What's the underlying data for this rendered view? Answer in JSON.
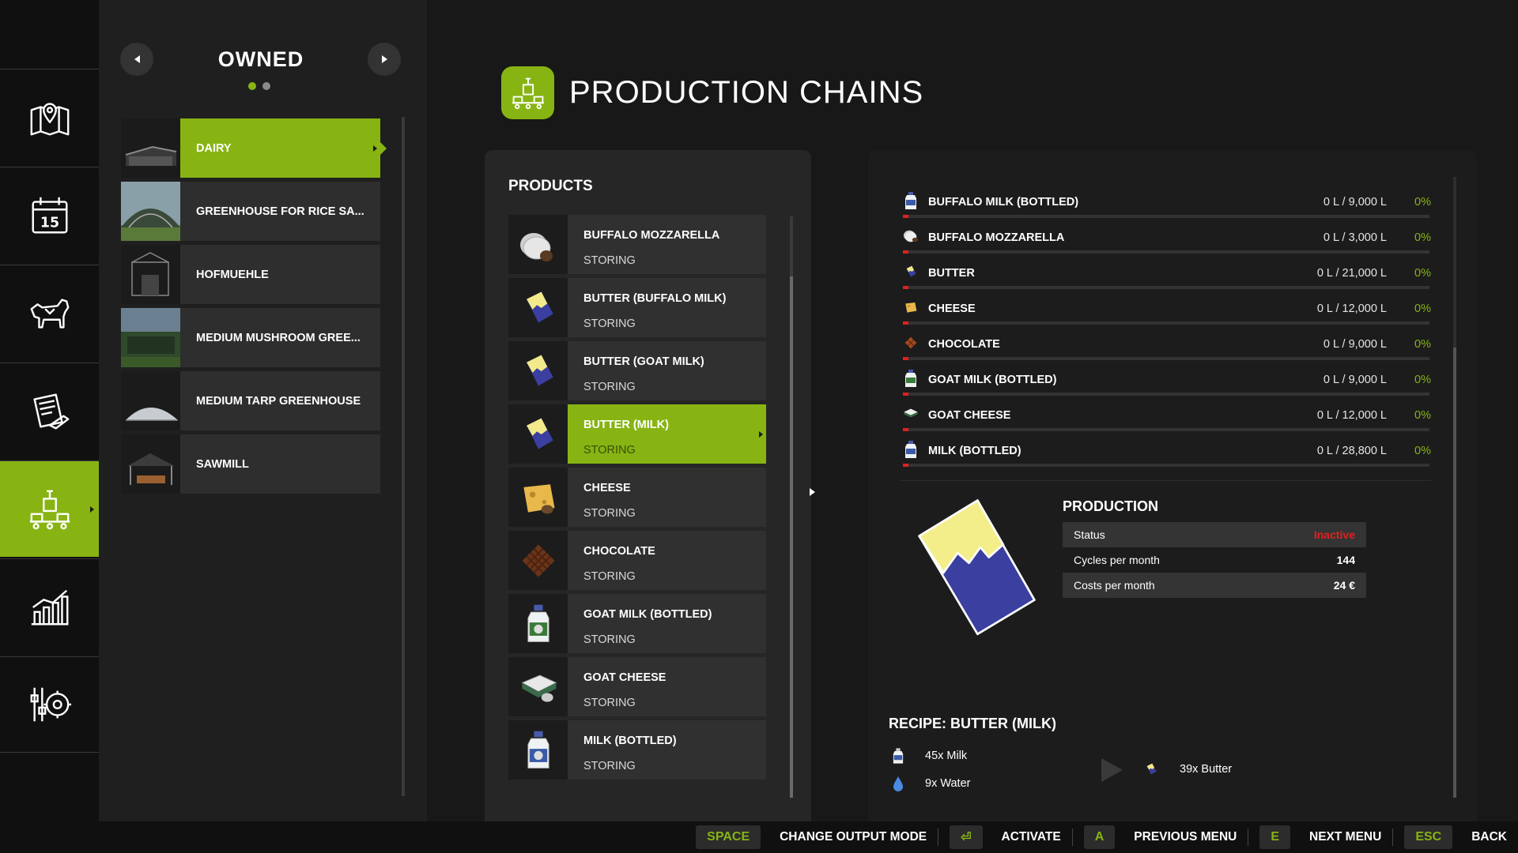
{
  "sidebar": {
    "items": [
      {
        "icon": "map-icon"
      },
      {
        "icon": "calendar-icon",
        "label": "15"
      },
      {
        "icon": "cow-icon"
      },
      {
        "icon": "contracts-icon"
      },
      {
        "icon": "production-icon",
        "active": true
      },
      {
        "icon": "statistics-icon"
      },
      {
        "icon": "settings-icon"
      }
    ]
  },
  "owned": {
    "title": "OWNED",
    "page_dots": {
      "count": 2,
      "active": 1
    },
    "items": [
      {
        "label": "DAIRY",
        "active": true
      },
      {
        "label": "GREENHOUSE FOR RICE SA..."
      },
      {
        "label": "HOFMUEHLE"
      },
      {
        "label": "MEDIUM MUSHROOM GREE..."
      },
      {
        "label": "MEDIUM TARP GREENHOUSE"
      },
      {
        "label": "SAWMILL"
      }
    ]
  },
  "header": {
    "title": "PRODUCTION CHAINS",
    "icon": "production-icon"
  },
  "products": {
    "title": "PRODUCTS",
    "items": [
      {
        "name": "BUFFALO MOZZARELLA",
        "status": "STORING",
        "icon": "mozzarella-icon"
      },
      {
        "name": "BUTTER (BUFFALO MILK)",
        "status": "STORING",
        "icon": "butter-icon"
      },
      {
        "name": "BUTTER (GOAT MILK)",
        "status": "STORING",
        "icon": "butter-icon"
      },
      {
        "name": "BUTTER (MILK)",
        "status": "STORING",
        "icon": "butter-icon",
        "active": true
      },
      {
        "name": "CHEESE",
        "status": "STORING",
        "icon": "cheese-icon"
      },
      {
        "name": "CHOCOLATE",
        "status": "STORING",
        "icon": "chocolate-icon"
      },
      {
        "name": "GOAT MILK (BOTTLED)",
        "status": "STORING",
        "icon": "goat-milk-bottle-icon"
      },
      {
        "name": "GOAT CHEESE",
        "status": "STORING",
        "icon": "goat-cheese-icon"
      },
      {
        "name": "MILK (BOTTLED)",
        "status": "STORING",
        "icon": "milk-bottle-icon"
      }
    ]
  },
  "storage": {
    "items": [
      {
        "name": "BUFFALO MILK (BOTTLED)",
        "amount": "0 L / 9,000 L",
        "percent": "0%",
        "fill": 0,
        "icon": "milk-bottle-icon"
      },
      {
        "name": "BUFFALO MOZZARELLA",
        "amount": "0 L / 3,000 L",
        "percent": "0%",
        "fill": 0,
        "icon": "mozzarella-icon"
      },
      {
        "name": "BUTTER",
        "amount": "0 L / 21,000 L",
        "percent": "0%",
        "fill": 0,
        "icon": "butter-icon"
      },
      {
        "name": "CHEESE",
        "amount": "0 L / 12,000 L",
        "percent": "0%",
        "fill": 0,
        "icon": "cheese-icon"
      },
      {
        "name": "CHOCOLATE",
        "amount": "0 L / 9,000 L",
        "percent": "0%",
        "fill": 0,
        "icon": "chocolate-icon"
      },
      {
        "name": "GOAT MILK (BOTTLED)",
        "amount": "0 L / 9,000 L",
        "percent": "0%",
        "fill": 0,
        "icon": "goat-milk-bottle-icon"
      },
      {
        "name": "GOAT CHEESE",
        "amount": "0 L / 12,000 L",
        "percent": "0%",
        "fill": 0,
        "icon": "goat-cheese-icon"
      },
      {
        "name": "MILK (BOTTLED)",
        "amount": "0 L / 28,800 L",
        "percent": "0%",
        "fill": 0,
        "icon": "milk-bottle-icon"
      }
    ]
  },
  "production": {
    "title": "PRODUCTION",
    "rows": [
      {
        "label": "Status",
        "value": "Inactive"
      },
      {
        "label": "Cycles per month",
        "value": "144"
      },
      {
        "label": "Costs per month",
        "value": "24 €"
      }
    ]
  },
  "recipe": {
    "title": "RECIPE: BUTTER (MILK)",
    "inputs": [
      {
        "text": "45x Milk",
        "icon": "milk-icon"
      },
      {
        "text": "9x Water",
        "icon": "water-drop-icon"
      }
    ],
    "output": {
      "text": "39x Butter",
      "icon": "butter-icon"
    }
  },
  "bottom_bar": {
    "hints": [
      {
        "key": "SPACE",
        "label": "CHANGE OUTPUT MODE"
      },
      {
        "key": "⏎",
        "label": "ACTIVATE"
      },
      {
        "key": "A",
        "label": "PREVIOUS MENU"
      },
      {
        "key": "E",
        "label": "NEXT MENU"
      },
      {
        "key": "ESC",
        "label": "BACK"
      }
    ]
  },
  "colors": {
    "accent": "#87b413",
    "inactive": "#e02020",
    "background": "#181818"
  }
}
